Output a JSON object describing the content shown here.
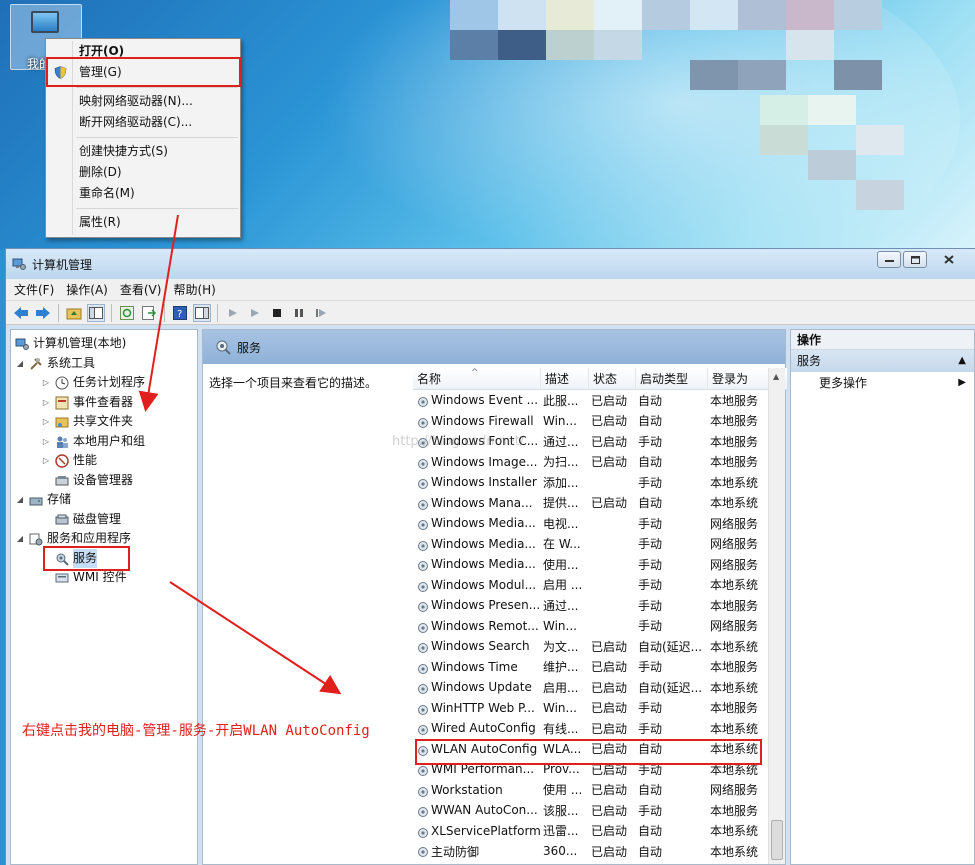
{
  "desktop": {
    "computer_icon_label": "我的"
  },
  "context_menu": {
    "items": [
      "打开(O)",
      "管理(G)",
      "映射网络驱动器(N)...",
      "断开网络驱动器(C)...",
      "创建快捷方式(S)",
      "删除(D)",
      "重命名(M)",
      "属性(R)"
    ]
  },
  "window": {
    "title": "计算机管理",
    "menu": [
      "文件(F)",
      "操作(A)",
      "查看(V)",
      "帮助(H)"
    ]
  },
  "tree": {
    "items": [
      "计算机管理(本地)",
      "系统工具",
      "任务计划程序",
      "事件查看器",
      "共享文件夹",
      "本地用户和组",
      "性能",
      "设备管理器",
      "存储",
      "磁盘管理",
      "服务和应用程序",
      "服务",
      "WMI 控件"
    ]
  },
  "services_panel": {
    "title": "服务",
    "description": "选择一个项目来查看它的描述。",
    "columns": [
      "名称",
      "描述",
      "状态",
      "启动类型",
      "登录为"
    ],
    "rows": [
      [
        "Windows Event ...",
        "此服...",
        "已启动",
        "自动",
        "本地服务"
      ],
      [
        "Windows Firewall",
        "Win...",
        "已启动",
        "自动",
        "本地服务"
      ],
      [
        "Windows Font C...",
        "通过...",
        "已启动",
        "手动",
        "本地服务"
      ],
      [
        "Windows Image...",
        "为扫...",
        "已启动",
        "自动",
        "本地服务"
      ],
      [
        "Windows Installer",
        "添加...",
        "",
        "手动",
        "本地系统"
      ],
      [
        "Windows Mana...",
        "提供...",
        "已启动",
        "自动",
        "本地系统"
      ],
      [
        "Windows Media...",
        "电视...",
        "",
        "手动",
        "网络服务"
      ],
      [
        "Windows Media...",
        "在 W...",
        "",
        "手动",
        "网络服务"
      ],
      [
        "Windows Media...",
        "使用...",
        "",
        "手动",
        "网络服务"
      ],
      [
        "Windows Modul...",
        "启用 ...",
        "",
        "手动",
        "本地系统"
      ],
      [
        "Windows Presen...",
        "通过...",
        "",
        "手动",
        "本地服务"
      ],
      [
        "Windows Remot...",
        "Win...",
        "",
        "手动",
        "网络服务"
      ],
      [
        "Windows Search",
        "为文...",
        "已启动",
        "自动(延迟...",
        "本地系统"
      ],
      [
        "Windows Time",
        "维护...",
        "已启动",
        "手动",
        "本地服务"
      ],
      [
        "Windows Update",
        "启用...",
        "已启动",
        "自动(延迟...",
        "本地系统"
      ],
      [
        "WinHTTP Web P...",
        "Win...",
        "已启动",
        "手动",
        "本地服务"
      ],
      [
        "Wired AutoConfig",
        "有线...",
        "已启动",
        "手动",
        "本地系统"
      ],
      [
        "WLAN AutoConfig",
        "WLA...",
        "已启动",
        "自动",
        "本地系统"
      ],
      [
        "WMI Performan...",
        "Prov...",
        "已启动",
        "手动",
        "本地系统"
      ],
      [
        "Workstation",
        "使用 ...",
        "已启动",
        "自动",
        "网络服务"
      ],
      [
        "WWAN AutoCon...",
        "该服...",
        "已启动",
        "手动",
        "本地服务"
      ],
      [
        "XLServicePlatform",
        "迅雷...",
        "已启动",
        "自动",
        "本地系统"
      ],
      [
        "主动防御",
        "360...",
        "已启动",
        "自动",
        "本地系统"
      ]
    ]
  },
  "actions": {
    "header": "操作",
    "section": "服务",
    "more": "更多操作"
  },
  "annotation": {
    "text": "右键点击我的电脑-管理-服务-开启WLAN AutoConfig",
    "watermark": "http://blog.csdn.net/"
  },
  "colors": {
    "annotation_red": "#e0201c",
    "header_blue": "#9bbbe0"
  }
}
